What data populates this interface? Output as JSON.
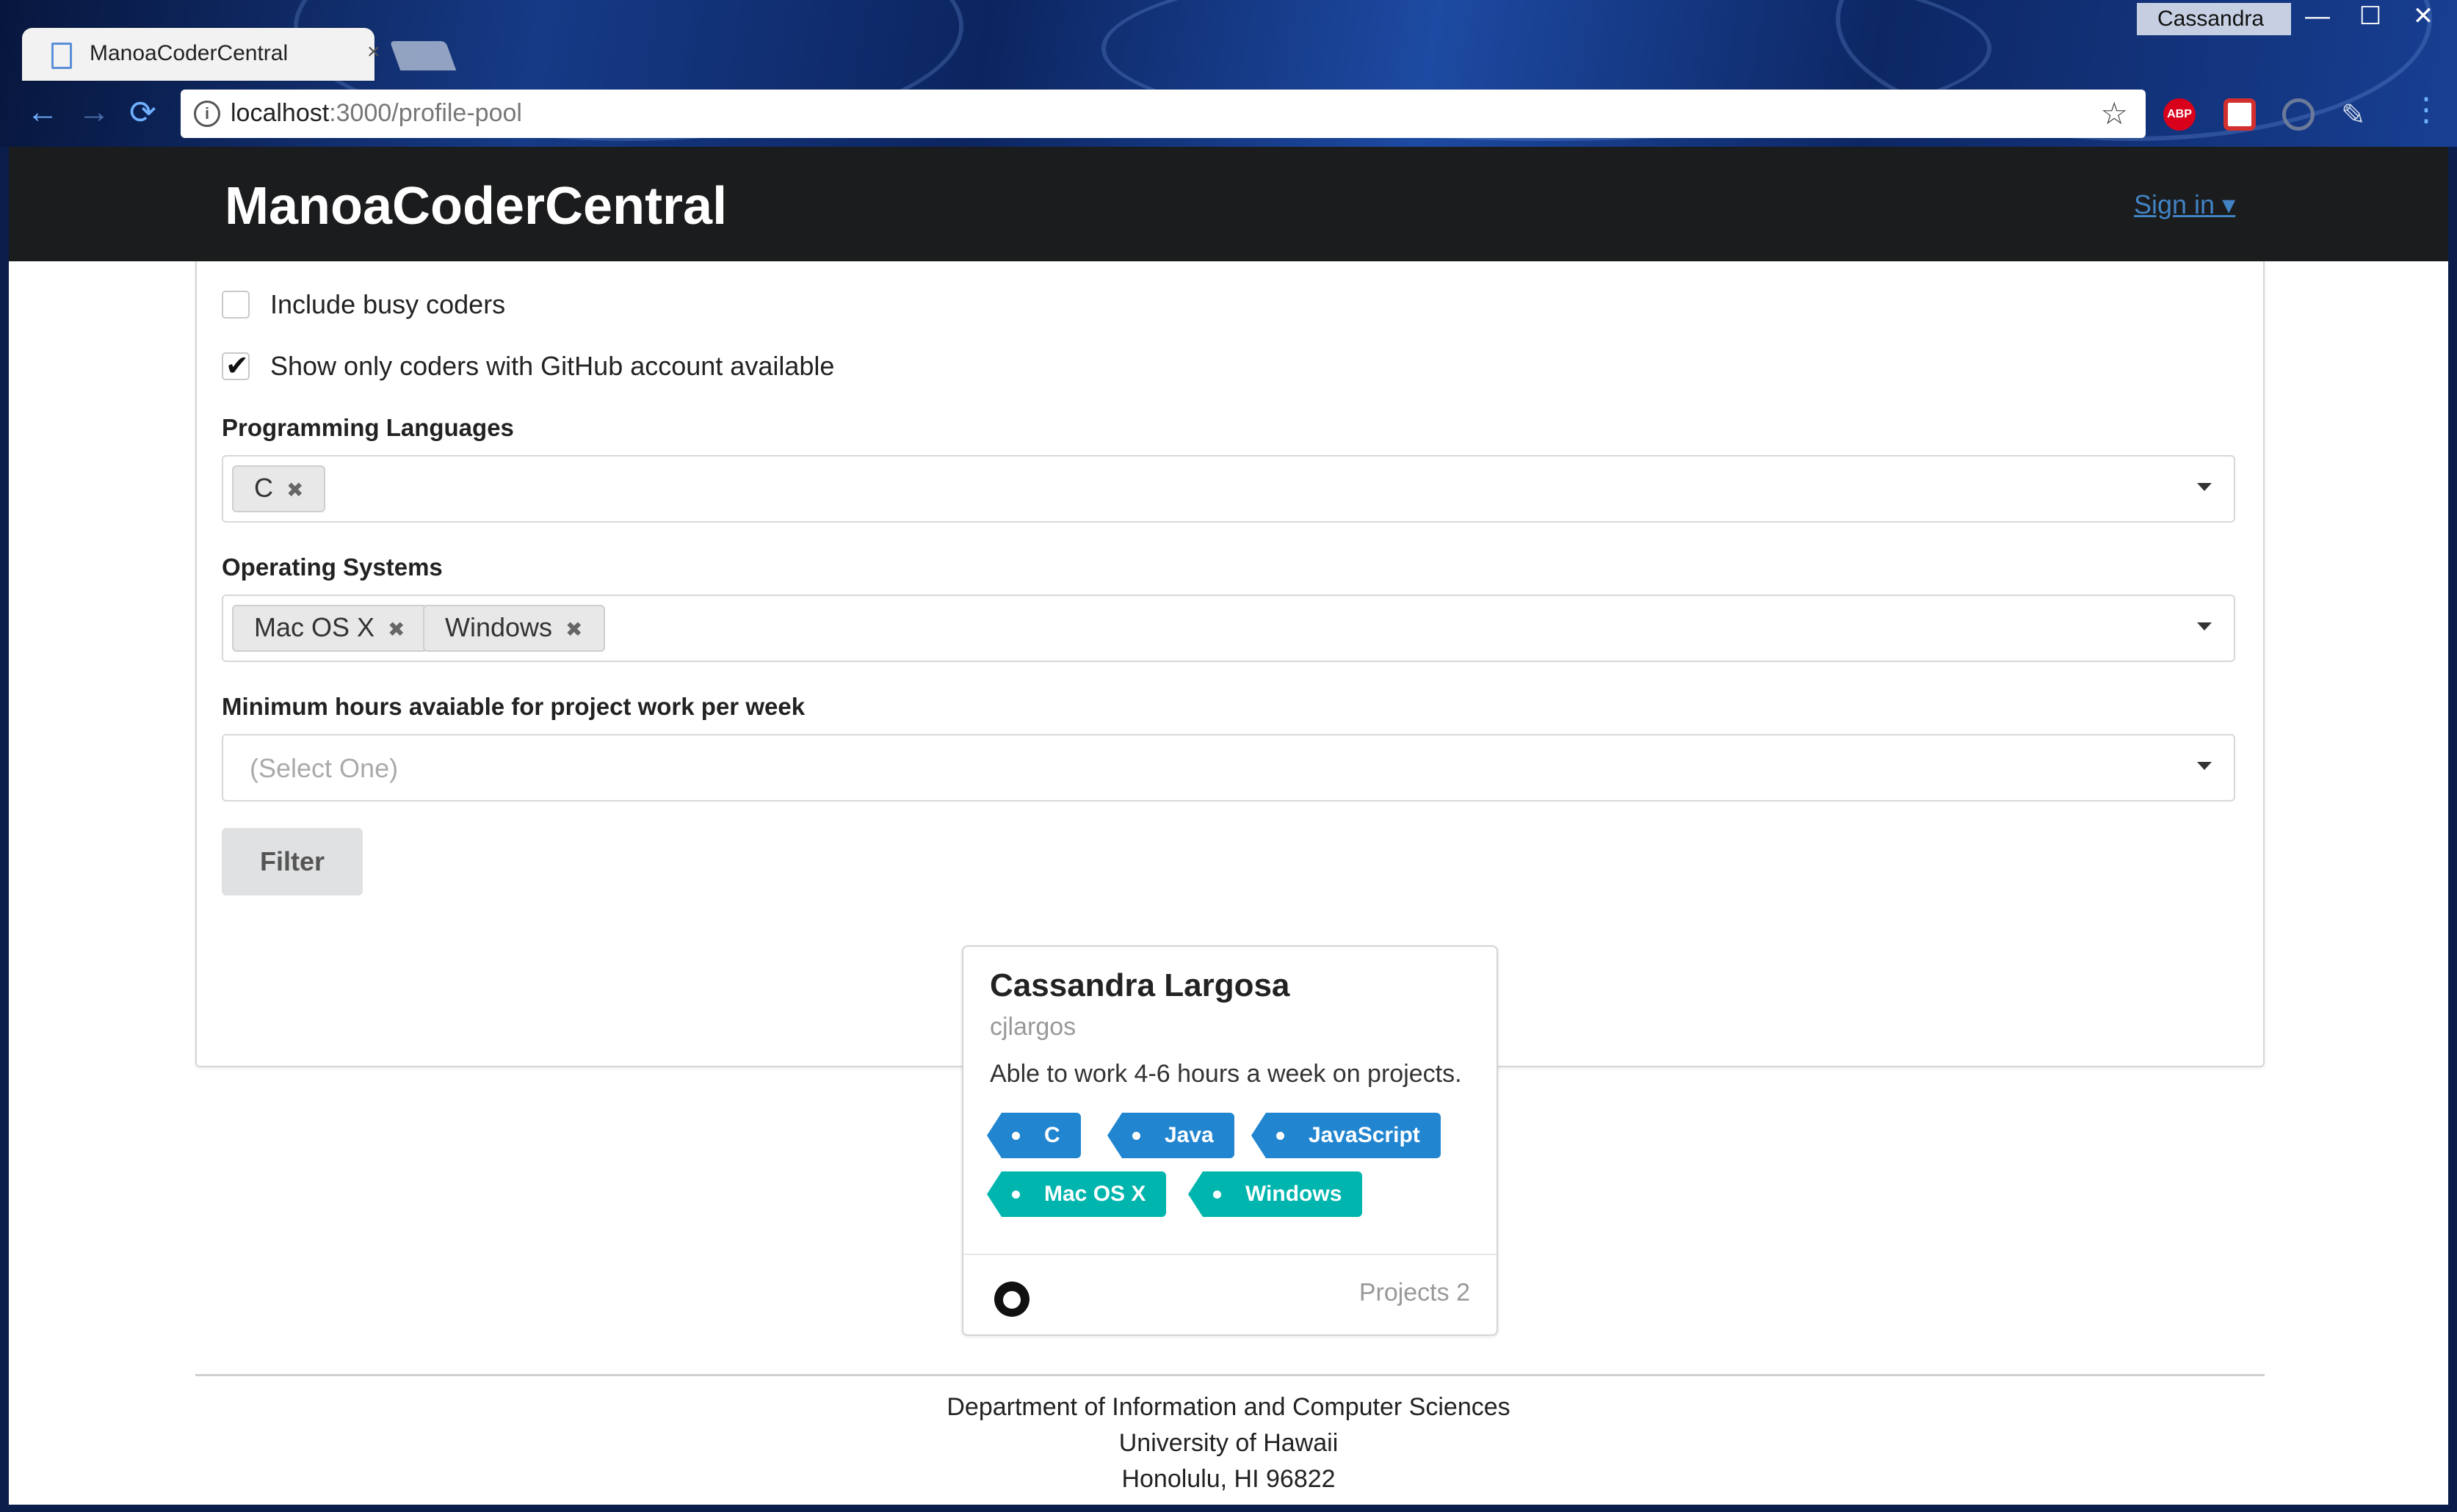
{
  "browser": {
    "tab_title": "ManoaCoderCentral",
    "tab_close": "×",
    "url_host": "localhost",
    "url_path": ":3000/profile-pool",
    "window_user": "Cassandra",
    "win_minimize": "—",
    "win_maximize": "☐",
    "win_close": "✕",
    "back": "←",
    "forward": "→",
    "reload": "⟳",
    "menu": "⋮",
    "ext_abp_label": "ABP"
  },
  "navbar": {
    "brand": "ManoaCoderCentral",
    "signin": "Sign in ▾"
  },
  "filters": {
    "include_busy_label": "Include busy coders",
    "include_busy_checked": false,
    "github_only_label": "Show only coders with GitHub account available",
    "github_only_checked": true,
    "languages_label": "Programming Languages",
    "languages_selected": [
      "C"
    ],
    "os_label": "Operating Systems",
    "os_selected": [
      "Mac OS X",
      "Windows"
    ],
    "hours_label": "Minimum hours avaiable for project work per week",
    "hours_placeholder": "(Select One)",
    "filter_button": "Filter",
    "chip_remove": "✖"
  },
  "profile_card": {
    "name": "Cassandra Largosa",
    "username": "cjlargos",
    "description": "Able to work 4-6 hours a week on projects.",
    "language_tags": [
      "C",
      "Java",
      "JavaScript"
    ],
    "os_tags": [
      "Mac OS X",
      "Windows"
    ],
    "projects_label": "Projects 2"
  },
  "footer": {
    "line1": "Department of Information and Computer Sciences",
    "line2": "University of Hawaii",
    "line3": "Honolulu, HI 96822"
  }
}
